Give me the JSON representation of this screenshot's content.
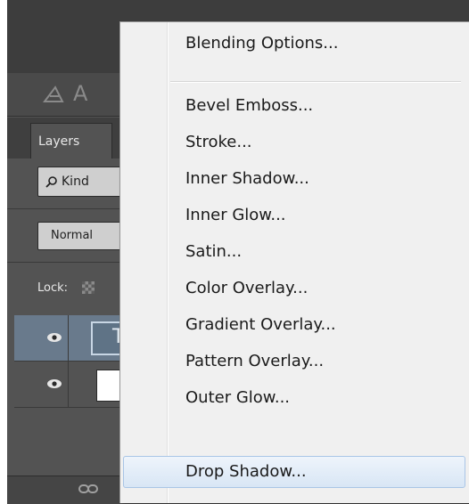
{
  "panel": {
    "tool_letter": "A",
    "tab_label": "Layers",
    "kind_label": "Kind",
    "blend_mode": "Normal",
    "lock_label": "Lock:",
    "layers": [
      {
        "thumb_text": "T",
        "selected": true
      },
      {
        "thumb_text": "",
        "selected": false
      }
    ]
  },
  "menu": {
    "items": [
      {
        "label": "Blending Options..."
      },
      {
        "label": "Bevel  Emboss..."
      },
      {
        "label": "Stroke..."
      },
      {
        "label": "Inner Shadow..."
      },
      {
        "label": "Inner Glow..."
      },
      {
        "label": "Satin..."
      },
      {
        "label": "Color Overlay..."
      },
      {
        "label": "Gradient Overlay..."
      },
      {
        "label": "Pattern Overlay..."
      },
      {
        "label": "Outer Glow..."
      },
      {
        "label": "Drop Shadow...",
        "highlighted": true
      }
    ]
  },
  "colors": {
    "panel_bg": "#535353",
    "selected_layer": "#697a8c",
    "menu_bg": "#f0f0f0",
    "menu_highlight_border": "#a9c5e6"
  }
}
